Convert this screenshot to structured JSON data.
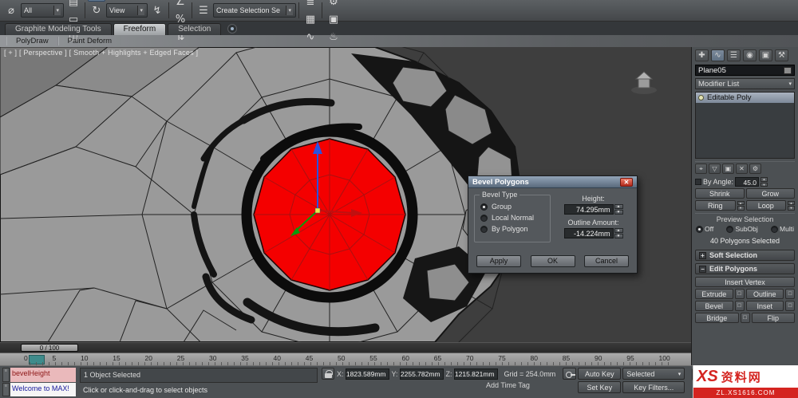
{
  "toolbar": {
    "group_a": [
      {
        "name": "select-and-link-icon",
        "glyph": "∞"
      },
      {
        "name": "unlink-selection-icon",
        "glyph": "⌀"
      },
      {
        "name": "bind-to-space-warp-icon",
        "glyph": "≋"
      }
    ],
    "selection_filter": "All",
    "group_b": [
      {
        "name": "select-object-icon",
        "glyph": "↖"
      },
      {
        "name": "select-by-name-icon",
        "glyph": "▤"
      },
      {
        "name": "rectangular-selection-region-icon",
        "glyph": "▭"
      },
      {
        "name": "window-crossing-icon",
        "glyph": "◫"
      }
    ],
    "group_c": [
      {
        "name": "select-and-move-icon",
        "glyph": "✚",
        "active": true
      },
      {
        "name": "select-and-rotate-icon",
        "glyph": "↻"
      },
      {
        "name": "select-and-scale-icon",
        "glyph": "⊡"
      }
    ],
    "coord_system": "View",
    "group_d": [
      {
        "name": "use-pivot-center-icon",
        "glyph": "⊕"
      },
      {
        "name": "select-and-manipulate-icon",
        "glyph": "↯"
      },
      {
        "name": "keyboard-override-icon",
        "glyph": "⌨"
      }
    ],
    "group_e": [
      {
        "name": "snap-toggle-3d-icon",
        "glyph": "3"
      },
      {
        "name": "angle-snap-icon",
        "glyph": "∠"
      },
      {
        "name": "percent-snap-icon",
        "glyph": "%"
      },
      {
        "name": "spinner-snap-icon",
        "glyph": "⇅"
      }
    ],
    "group_f": [
      {
        "name": "edit-named-selection-sets-icon",
        "glyph": "☰"
      }
    ],
    "selection_set": "Create Selection Se",
    "group_g": [
      {
        "name": "mirror-icon",
        "glyph": "⋈"
      },
      {
        "name": "align-icon",
        "glyph": "∥"
      },
      {
        "name": "layer-manager-icon",
        "glyph": "≣"
      },
      {
        "name": "graphite-ribbon-icon",
        "glyph": "▦"
      },
      {
        "name": "curve-editor-icon",
        "glyph": "∿"
      },
      {
        "name": "schematic-view-icon",
        "glyph": "⊞"
      }
    ],
    "group_h": [
      {
        "name": "material-editor-icon",
        "glyph": "◉"
      },
      {
        "name": "render-setup-icon",
        "glyph": "⚙"
      },
      {
        "name": "rendered-frame-window-icon",
        "glyph": "▣"
      },
      {
        "name": "render-production-icon",
        "glyph": "♨"
      }
    ],
    "dropdown_arrow": "▾"
  },
  "ribbon": {
    "tabs": [
      "Graphite Modeling Tools",
      "Freeform",
      "Selection"
    ],
    "active_tab": "Freeform",
    "subtabs": [
      "PolyDraw",
      "Paint Deform"
    ]
  },
  "viewport": {
    "label": "[ + ] [ Perspective ] [ Smooth + Highlights + Edged Faces ]"
  },
  "dialog": {
    "title": "Bevel Polygons",
    "close": "✕",
    "group_label": "Bevel Type",
    "radios": [
      "Group",
      "Local Normal",
      "By Polygon"
    ],
    "selected_radio": "Group",
    "height_label": "Height:",
    "height_value": "74.295mm",
    "outline_label": "Outline Amount:",
    "outline_value": "-14.224mm",
    "apply": "Apply",
    "ok": "OK",
    "cancel": "Cancel"
  },
  "panel": {
    "tabs": [
      {
        "name": "create-tab-icon",
        "glyph": "✚"
      },
      {
        "name": "modify-tab-icon",
        "glyph": "∿",
        "active": true
      },
      {
        "name": "hierarchy-tab-icon",
        "glyph": "☰"
      },
      {
        "name": "motion-tab-icon",
        "glyph": "◉"
      },
      {
        "name": "display-tab-icon",
        "glyph": "▣"
      },
      {
        "name": "utilities-tab-icon",
        "glyph": "⚒"
      }
    ],
    "object_name": "Plane05",
    "modifier_list": "Modifier List",
    "stack_selected": "Editable Poly",
    "stack_tools": [
      {
        "name": "pin-stack-icon",
        "glyph": "⌖"
      },
      {
        "name": "show-end-result-icon",
        "glyph": "▽"
      },
      {
        "name": "make-unique-icon",
        "glyph": "▣"
      },
      {
        "name": "remove-modifier-icon",
        "glyph": "✕"
      },
      {
        "name": "configure-modifier-sets-icon",
        "glyph": "⚙"
      }
    ],
    "by_angle_label": "By Angle:",
    "by_angle_value": "45.0",
    "shrink": "Shrink",
    "grow": "Grow",
    "ring": "Ring",
    "loop": "Loop",
    "preview_selection_label": "Preview Selection",
    "preview_options": [
      "Off",
      "SubObj",
      "Multi"
    ],
    "preview_selected": "Off",
    "selection_status": "40 Polygons Selected",
    "soft_selection": "Soft Selection",
    "edit_polygons": "Edit Polygons",
    "insert_vertex": "Insert Vertex",
    "extrude": "Extrude",
    "outline": "Outline",
    "bevel": "Bevel",
    "inset": "Inset",
    "bridge": "Bridge",
    "flip": "Flip"
  },
  "timeline": {
    "slider": "0 / 100",
    "ticks": [
      "0",
      "5",
      "10",
      "15",
      "20",
      "25",
      "30",
      "35",
      "40",
      "45",
      "50",
      "55",
      "60",
      "65",
      "70",
      "75",
      "80",
      "85",
      "90",
      "95",
      "100"
    ]
  },
  "status": {
    "listener_line1": "bevelHeight",
    "listener_line2": "Welcome to MAX!",
    "selection": "1 Object Selected",
    "prompt": "Click or click-and-drag to select objects",
    "x_label": "X:",
    "x_value": "1823.589mm",
    "y_label": "Y:",
    "y_value": "2255.782mm",
    "z_label": "Z:",
    "z_value": "1215.821mm",
    "grid": "Grid = 254.0mm",
    "add_time_tag": "Add Time Tag",
    "auto_key": "Auto Key",
    "set_key": "Set Key",
    "key_mode": "Selected",
    "key_filters": "Key Filters...",
    "transport": [
      {
        "name": "go-to-start-icon",
        "glyph": "|◀"
      },
      {
        "name": "previous-frame-icon",
        "glyph": "◀"
      },
      {
        "name": "play-icon",
        "glyph": "▶"
      }
    ]
  },
  "watermark": {
    "logo": "XS",
    "site_name": "资料网",
    "url": "ZL.XS1616.COM"
  }
}
